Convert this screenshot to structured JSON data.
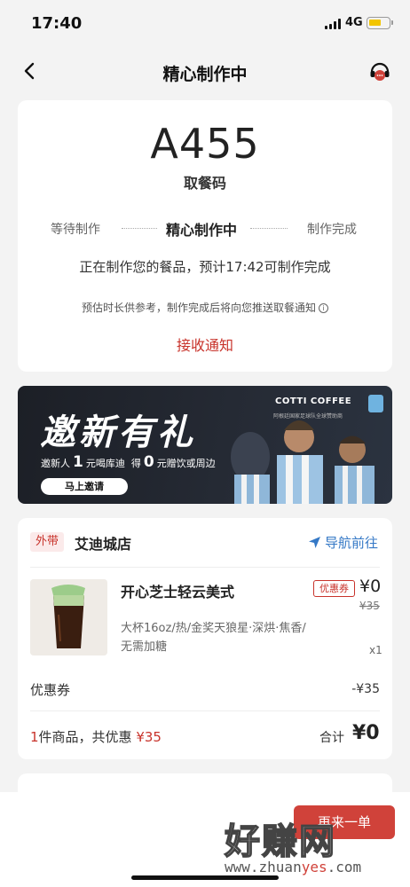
{
  "status_bar": {
    "time": "17:40",
    "network": "4G",
    "battery_color": "#f2c500"
  },
  "nav": {
    "title": "精心制作中",
    "back_icon": "chevron-left-icon",
    "service_icon": "headset-icon"
  },
  "order_status": {
    "pickup_code": "A455",
    "pickup_label": "取餐码",
    "steps": [
      "等待制作",
      "精心制作中",
      "制作完成"
    ],
    "active_step": 1,
    "progress_text": "正在制作您的餐品，预计17:42可制作完成",
    "estimate_note": "预估时长供参考，制作完成后将向您推送取餐通知",
    "notify_link": "接收通知"
  },
  "banner": {
    "title": "邀新有礼",
    "sub_prefix": "邀新人",
    "sub_num_1": "1",
    "sub_mid": "元喝库迪",
    "sub_get": "得",
    "sub_num_2": "0",
    "sub_suffix": "元赠饮或周边",
    "button": "马上邀请",
    "brand": "COTTI COFFEE",
    "tagline": "阿根廷国家足球队全球赞助商"
  },
  "order": {
    "delivery_type": "外带",
    "store_name": "艾迪城店",
    "nav_link": "导航前往",
    "product": {
      "name": "开心芝士轻云美式",
      "coupon_tag": "优惠券",
      "price": "¥0",
      "original_price": "¥35",
      "spec": "大杯16oz/热/金奖天狼星·深烘·焦香/无需加糖",
      "quantity": "x1"
    },
    "discount_label": "优惠券",
    "discount_value": "-¥35",
    "summary_count": "1",
    "summary_mid": "件商品，共优惠",
    "summary_discount": "¥35",
    "total_label": "合计",
    "total_value": "¥0"
  },
  "bottom": {
    "button_label": "再来一单"
  },
  "watermark": {
    "text": "好赚网",
    "url_prefix": "www.zhuan",
    "url_highlight": "yes",
    "url_suffix": ".com"
  },
  "colors": {
    "accent_red": "#c8332b",
    "link_blue": "#3478c6"
  }
}
